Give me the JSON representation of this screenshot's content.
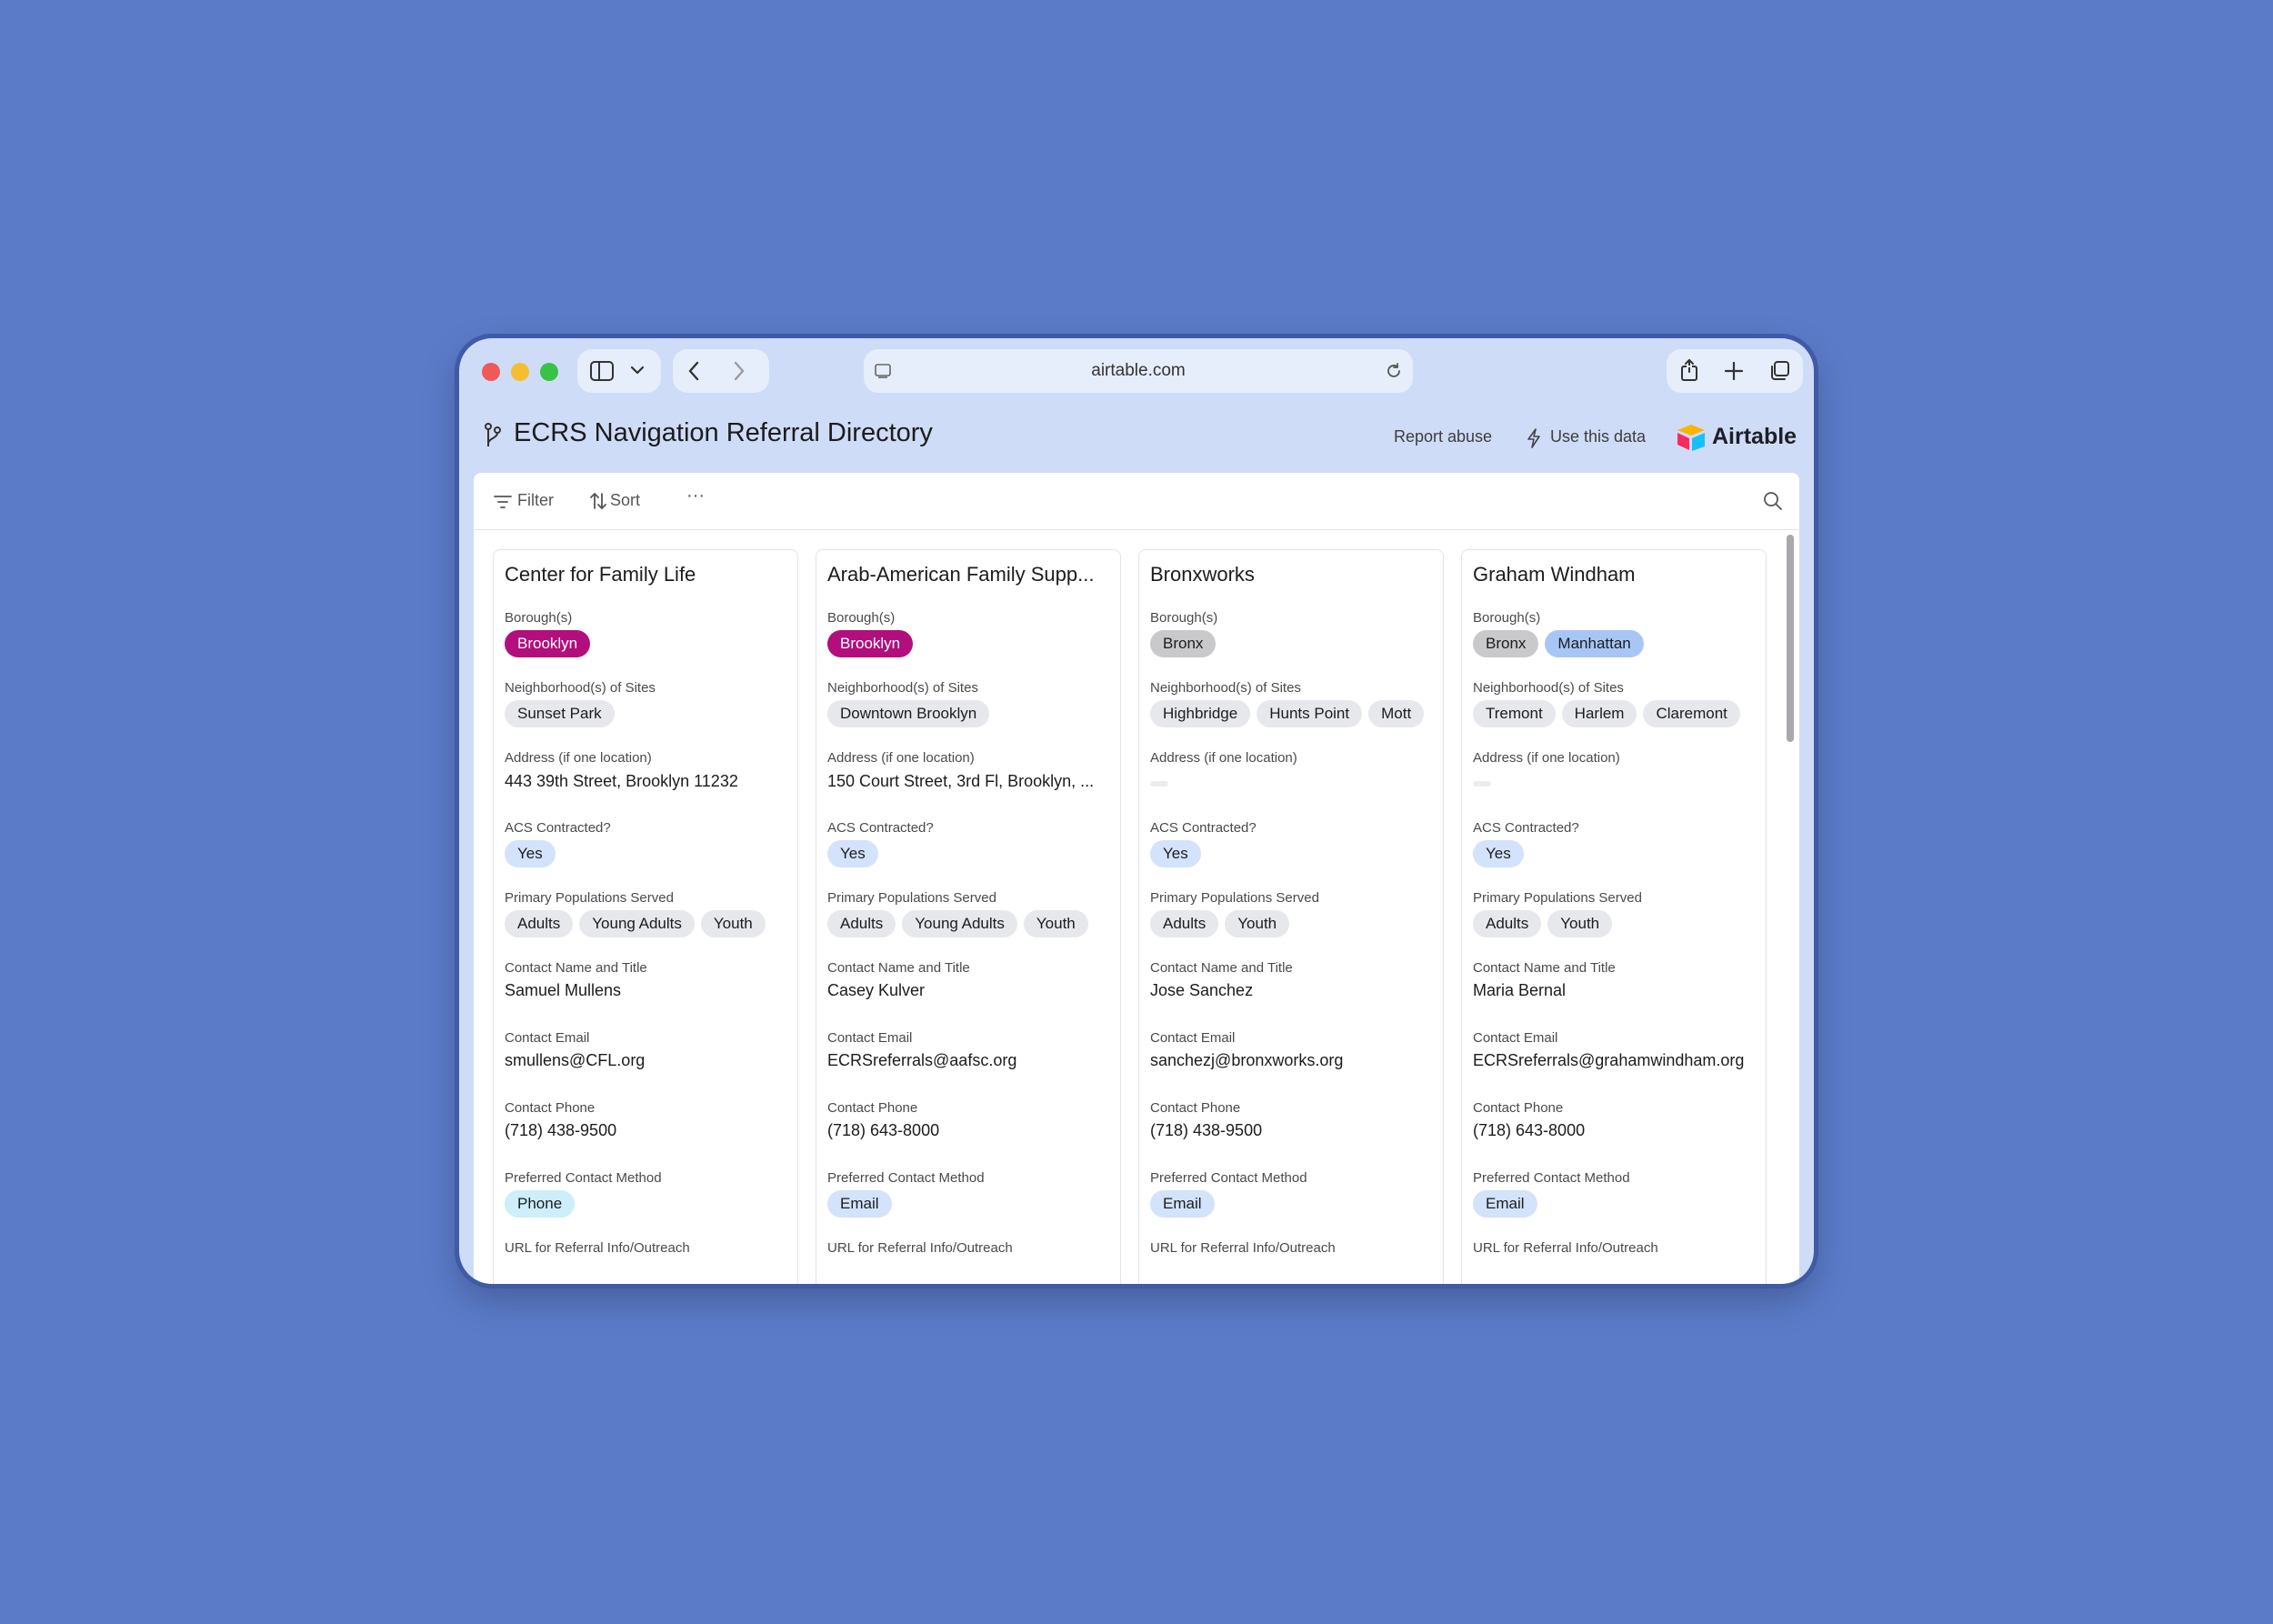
{
  "browser": {
    "url": "airtable.com"
  },
  "header": {
    "title": "ECRS Navigation Referral Directory",
    "report_abuse": "Report abuse",
    "use_data": "Use this data",
    "brand": "Airtable"
  },
  "toolbar": {
    "filter": "Filter",
    "sort": "Sort",
    "more": "···"
  },
  "labels": {
    "boroughs": "Borough(s)",
    "neighborhoods": "Neighborhood(s) of Sites",
    "address": "Address (if one location)",
    "acs": "ACS Contracted?",
    "populations": "Primary Populations Served",
    "contact_name": "Contact Name and Title",
    "contact_email": "Contact Email",
    "contact_phone": "Contact Phone",
    "preferred_method": "Preferred Contact Method",
    "url": "URL for Referral Info/Outreach"
  },
  "cards": [
    {
      "name": "Center for Family Life",
      "boroughs": [
        "Brooklyn"
      ],
      "neighborhoods": [
        "Sunset Park"
      ],
      "address": "443 39th Street, Brooklyn 11232",
      "acs": "Yes",
      "populations": [
        "Adults",
        "Young Adults",
        "Youth"
      ],
      "contact_name": "Samuel Mullens",
      "contact_email": "smullens@CFL.org",
      "contact_phone": "(718) 438-9500",
      "preferred_method": "Phone"
    },
    {
      "name": "Arab-American Family Supp...",
      "boroughs": [
        "Brooklyn"
      ],
      "neighborhoods": [
        "Downtown Brooklyn"
      ],
      "address": "150 Court Street, 3rd Fl, Brooklyn, ...",
      "acs": "Yes",
      "populations": [
        "Adults",
        "Young Adults",
        "Youth"
      ],
      "contact_name": "Casey Kulver",
      "contact_email": "ECRSreferrals@aafsc.org",
      "contact_phone": "(718) 643-8000",
      "preferred_method": "Email"
    },
    {
      "name": "Bronxworks",
      "boroughs": [
        "Bronx"
      ],
      "neighborhoods": [
        "Highbridge",
        "Hunts Point",
        "Mott"
      ],
      "address": "",
      "acs": "Yes",
      "populations": [
        "Adults",
        "Youth"
      ],
      "contact_name": "Jose Sanchez",
      "contact_email": "sanchezj@bronxworks.org",
      "contact_phone": "(718) 438-9500",
      "preferred_method": "Email"
    },
    {
      "name": "Graham Windham",
      "boroughs": [
        "Bronx",
        "Manhattan"
      ],
      "neighborhoods": [
        "Tremont",
        "Harlem",
        "Claremont"
      ],
      "address": "",
      "acs": "Yes",
      "populations": [
        "Adults",
        "Youth"
      ],
      "contact_name": "Maria Bernal",
      "contact_email": "ECRSreferrals@grahamwindham.org",
      "contact_phone": "(718) 643-8000",
      "preferred_method": "Email"
    }
  ]
}
